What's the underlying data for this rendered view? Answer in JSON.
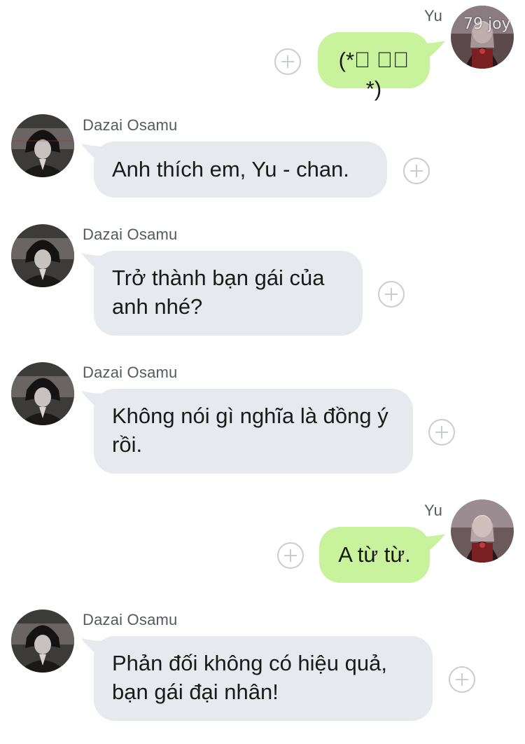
{
  "messages": [
    {
      "sender": "Yu",
      "text": "(*ﾟ ∀ﾟ *)"
    },
    {
      "sender": "Dazai Osamu",
      "text": "Anh thích em, Yu - chan."
    },
    {
      "sender": "Dazai Osamu",
      "text": "Trở thành bạn gái của anh nhé?"
    },
    {
      "sender": "Dazai Osamu",
      "text": "Không nói gì nghĩa là đồng ý rồi."
    },
    {
      "sender": "Yu",
      "text": "A từ từ."
    },
    {
      "sender": "Dazai Osamu",
      "text": "Phản đối không có hiệu quả, bạn gái đại nhân!"
    }
  ],
  "watermark": "79 joy",
  "icons": {
    "add": "plus-circle-icon",
    "avatar_dazai": "dazai-avatar",
    "avatar_yu": "yu-avatar"
  },
  "colors": {
    "incoming_bubble": "#e6e9ed",
    "outgoing_bubble": "#c9f29c",
    "background": "#ffffff"
  }
}
